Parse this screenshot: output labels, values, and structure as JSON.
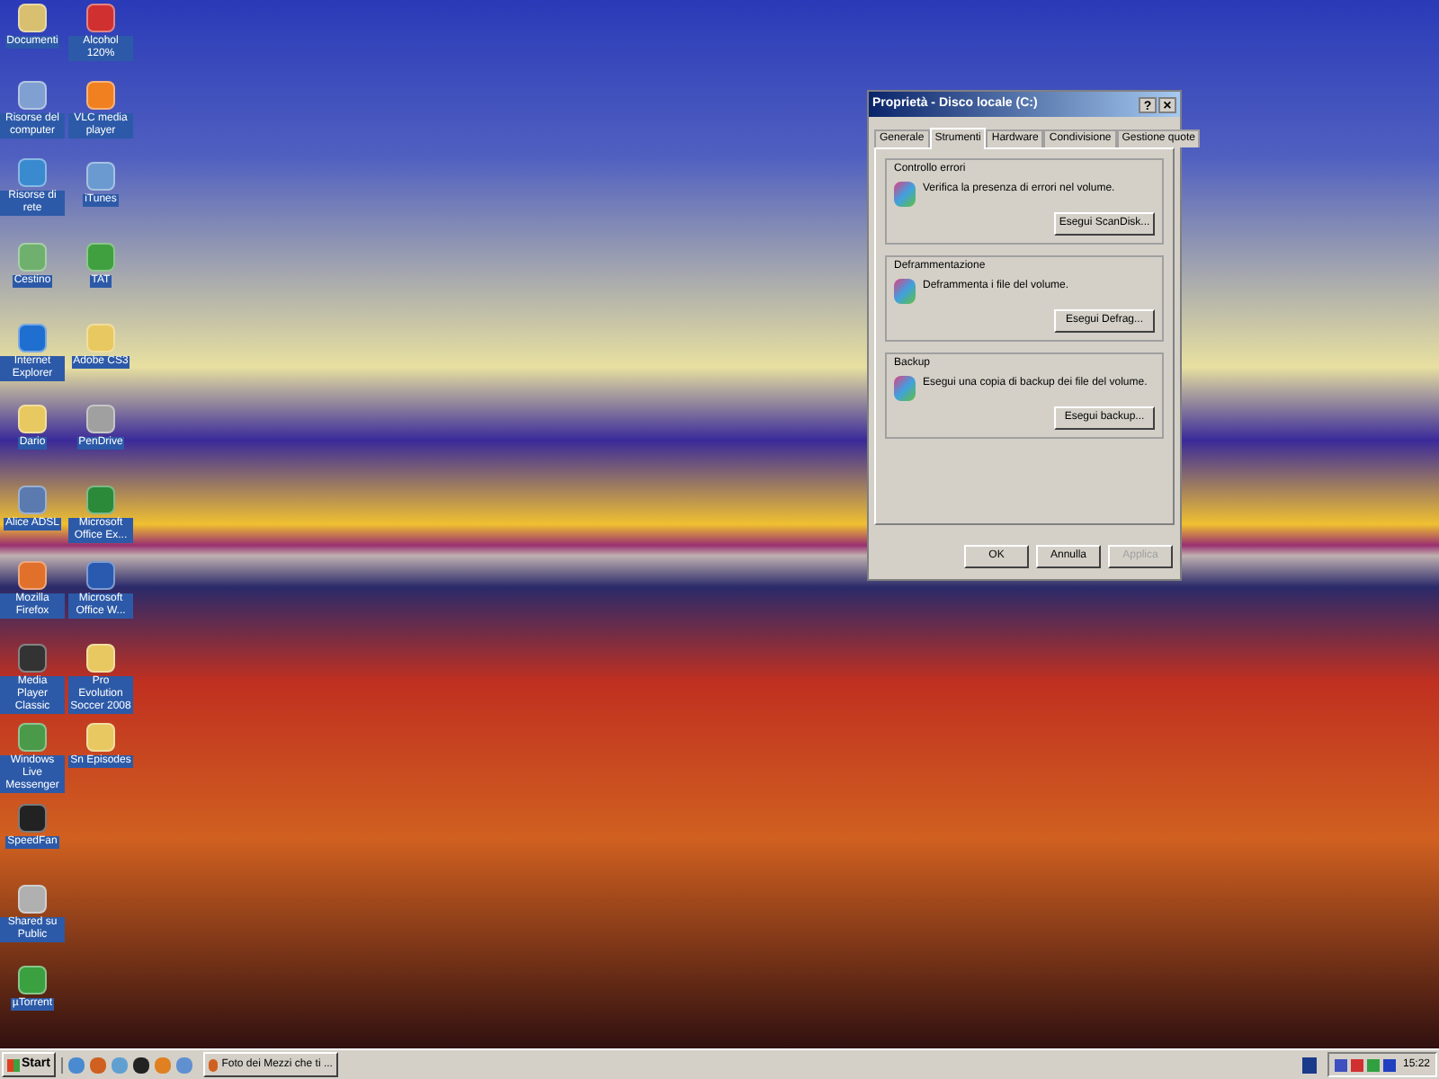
{
  "desktop_icons_column_1": [
    {
      "label": "Documenti"
    },
    {
      "label": "Risorse del computer"
    },
    {
      "label": "Risorse di rete"
    },
    {
      "label": "Cestino"
    },
    {
      "label": "Internet Explorer"
    },
    {
      "label": "Dario"
    },
    {
      "label": "Alice ADSL"
    },
    {
      "label": "Mozilla Firefox"
    },
    {
      "label": "Media Player Classic"
    },
    {
      "label": "Windows Live Messenger"
    },
    {
      "label": "SpeedFan"
    },
    {
      "label": "Shared su Public"
    },
    {
      "label": "µTorrent"
    }
  ],
  "desktop_icons_column_2": [
    {
      "label": "Alcohol 120%"
    },
    {
      "label": "VLC media player"
    },
    {
      "label": "iTunes"
    },
    {
      "label": "TAT"
    },
    {
      "label": "Adobe CS3"
    },
    {
      "label": "PenDrive"
    },
    {
      "label": "Microsoft Office Ex..."
    },
    {
      "label": "Microsoft Office W..."
    },
    {
      "label": "Pro Evolution Soccer 2008"
    },
    {
      "label": "Sn Episodes"
    }
  ],
  "window": {
    "title": "Proprietà - Disco locale (C:)",
    "help_button": "?",
    "close_button": "×",
    "tabs": [
      {
        "label": "Generale",
        "selected": false
      },
      {
        "label": "Strumenti",
        "selected": true
      },
      {
        "label": "Hardware",
        "selected": false
      },
      {
        "label": "Condivisione",
        "selected": false
      },
      {
        "label": "Gestione quote",
        "selected": false
      }
    ],
    "groups": [
      {
        "title": "Controllo errori",
        "text": "Verifica la presenza di errori nel volume.",
        "button": "Esegui ScanDisk..."
      },
      {
        "title": "Deframmentazione",
        "text": "Deframmenta i file del volume.",
        "button": "Esegui Defrag..."
      },
      {
        "title": "Backup",
        "text": "Esegui una copia di backup dei file del volume.",
        "button": "Esegui backup..."
      }
    ],
    "buttons": [
      {
        "label": "OK",
        "disabled": false
      },
      {
        "label": "Annulla",
        "disabled": false
      },
      {
        "label": "Applica",
        "disabled": true
      }
    ]
  },
  "taskbar": {
    "start": "Start",
    "tasks": [
      {
        "label": "Foto dei Mezzi che ti ...",
        "selected": false
      }
    ],
    "clock": "15:22"
  }
}
